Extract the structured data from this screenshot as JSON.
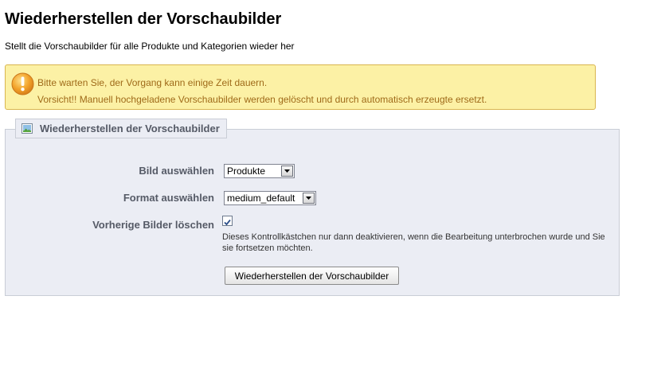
{
  "header": {
    "title": "Wiederherstellen der Vorschaubilder",
    "subtitle": "Stellt die Vorschaubilder für alle Produkte und Kategorien wieder her"
  },
  "warning": {
    "icon": "warning-icon",
    "line1": "Bitte warten Sie, der Vorgang kann einige Zeit dauern.",
    "line2": "Vorsicht!! Manuell hochgeladene Vorschaubilder werden gelöscht und durch automatisch erzeugte ersetzt.",
    "color_bg": "#fcf1a5",
    "color_text": "#9f6a19"
  },
  "form": {
    "legend": "Wiederherstellen der Vorschaubilder",
    "legend_icon": "image-icon",
    "image_label": "Bild auswählen",
    "image_value": "Produkte",
    "format_label": "Format auswählen",
    "format_value": "medium_default",
    "delete_label": "Vorherige Bilder löschen",
    "delete_checked": true,
    "help_text": "Dieses Kontrollkästchen nur dann deaktivieren, wenn die Bearbeitung unterbrochen wurde und Sie sie fortsetzen möchten.",
    "submit_label": "Wiederherstellen der Vorschaubilder"
  }
}
